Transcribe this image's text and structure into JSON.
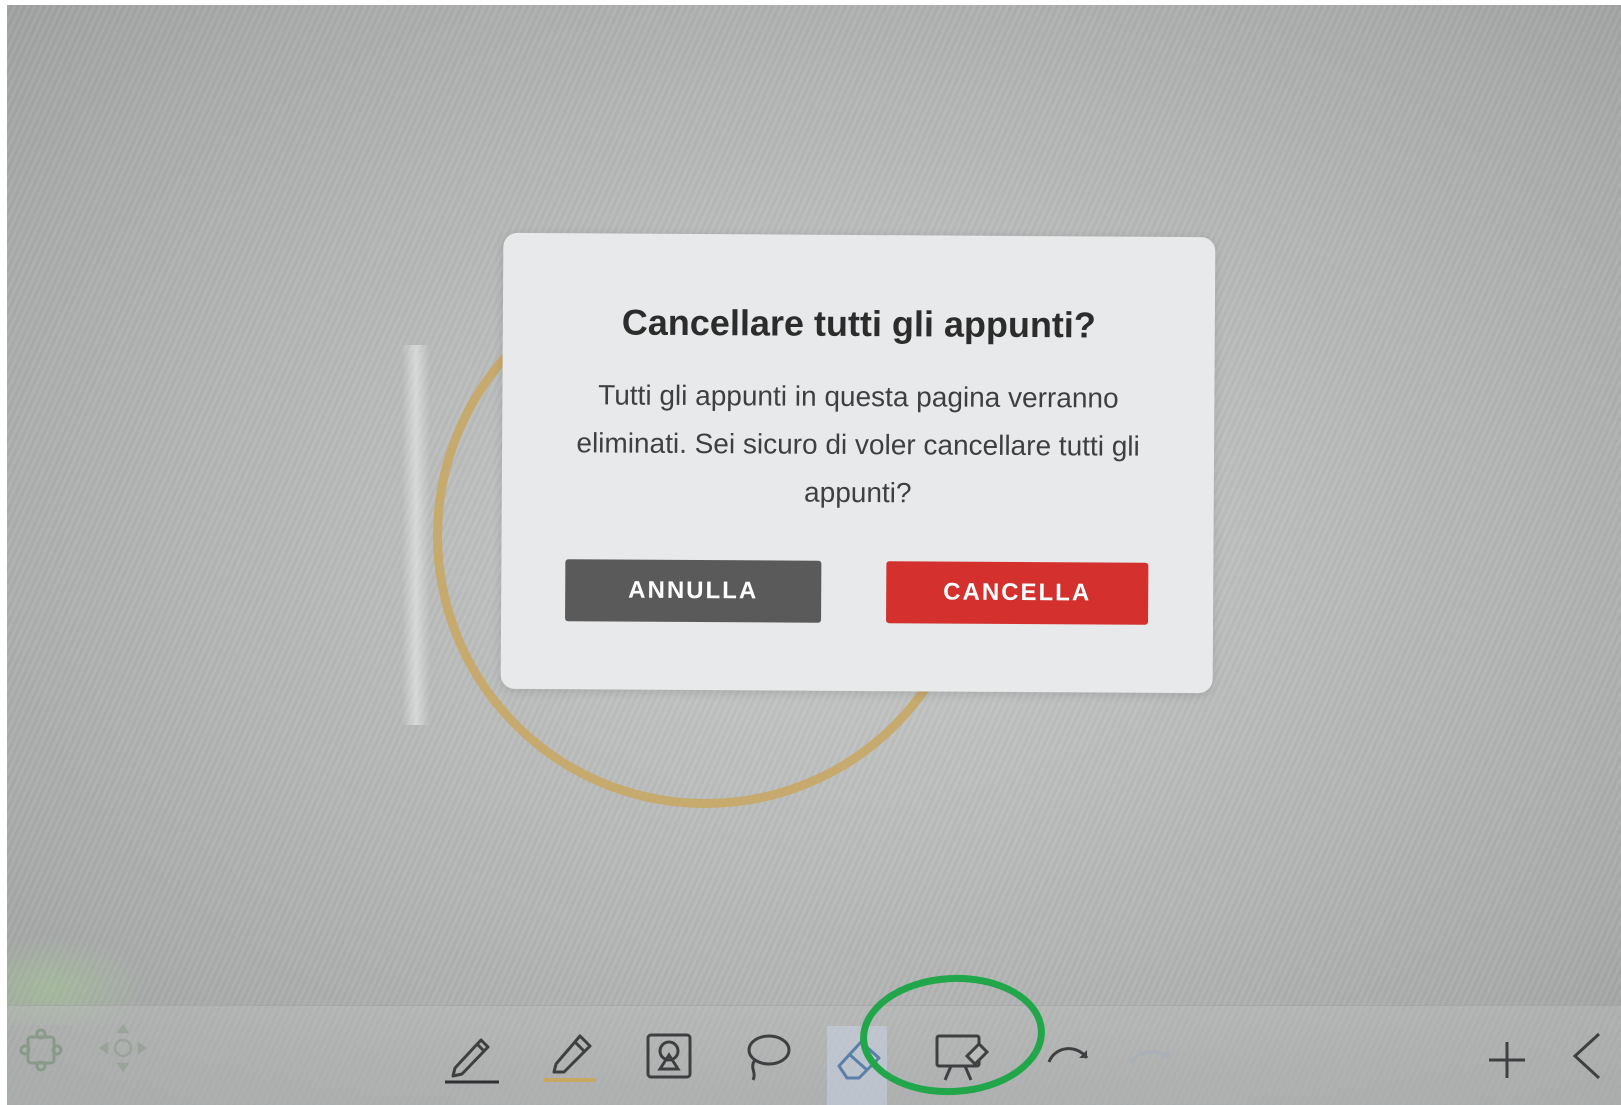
{
  "dialog": {
    "title": "Cancellare tutti gli appunti?",
    "message": "Tutti gli appunti in questa pagina verranno eliminati. Sei sicuro di voler cancellare tutti gli appunti?",
    "cancel_label": "ANNULLA",
    "confirm_label": "CANCELLA"
  },
  "toolbar": {
    "left_tools": [
      {
        "icon": "puzzle-icon"
      },
      {
        "icon": "move-arrows-icon"
      }
    ],
    "center_tools": [
      {
        "icon": "pen-icon"
      },
      {
        "icon": "highlighter-icon"
      },
      {
        "icon": "shape-recognition-icon"
      },
      {
        "icon": "lasso-icon"
      },
      {
        "icon": "eraser-icon",
        "active": true
      },
      {
        "icon": "clear-board-icon",
        "highlighted": true
      },
      {
        "icon": "undo-icon"
      },
      {
        "icon": "redo-icon"
      }
    ],
    "right_tools": [
      {
        "icon": "plus-icon"
      },
      {
        "icon": "chevron-left-icon"
      }
    ]
  },
  "colors": {
    "confirm_button": "#d4302d",
    "cancel_button": "#5a5a5a",
    "highlight_annotation": "#22a64a",
    "background_ring": "#c8a765"
  }
}
